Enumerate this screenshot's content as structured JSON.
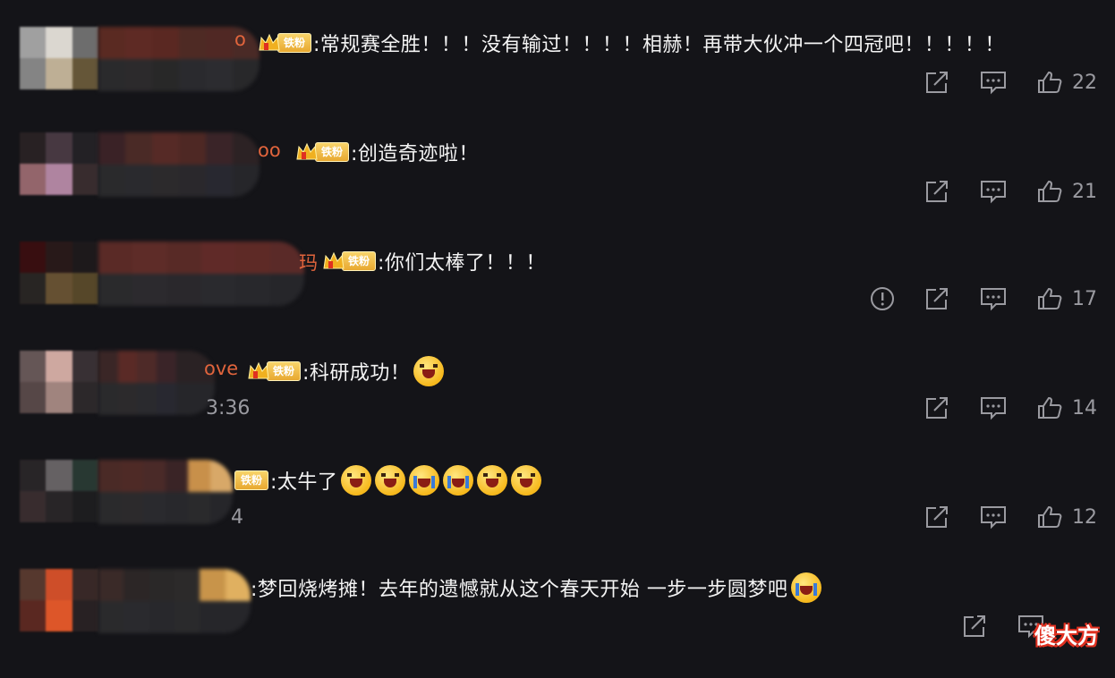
{
  "comments": [
    {
      "name_tail": "o",
      "badge": "铁粉",
      "text": ":常规赛全胜！！！没有输过！！！！相赫！再带大伙冲一个四冠吧！！！！！",
      "time": "",
      "likes": "22",
      "avatar_colors": [
        "#a8a8a8",
        "#e6e2da",
        "#727272",
        "#8a8a8a",
        "#c8b89c",
        "#6a5a3a"
      ],
      "name_colors": [
        "#5a2a22",
        "#5e2a24",
        "#5a2822",
        "#4e2a24",
        "#502824",
        "#4a2a26",
        "#2a2a2c",
        "#2c2a2c",
        "#282828",
        "#2a2a2e",
        "#2c2c30",
        "#28282a"
      ]
    },
    {
      "name_tail": "oo",
      "badge": "铁粉",
      "text": ":创造奇迹啦！",
      "time": "",
      "likes": "21",
      "avatar_colors": [
        "#2a2224",
        "#4a3a44",
        "#242226",
        "#9a6a70",
        "#b88aa8",
        "#3a2e30"
      ],
      "name_colors": [
        "#3a2226",
        "#4a2a26",
        "#562a26",
        "#4e2824",
        "#3a2428",
        "#2c2224",
        "#2a2a2c",
        "#2a2a2e",
        "#2c2a2c",
        "#2a282c",
        "#282830",
        "#26262a"
      ]
    },
    {
      "name_tail": "玛",
      "badge": "铁粉",
      "text": ":你们太棒了！！！",
      "time": "",
      "likes": "17",
      "avatar_colors": [
        "#3a0e10",
        "#2a1a1a",
        "#1e1a1c",
        "#2a2624",
        "#6a5434",
        "#5a4a2a"
      ],
      "name_colors": [
        "#5a2a26",
        "#5e2c28",
        "#582a26",
        "#602a28",
        "#5e2a26",
        "#5a2a28",
        "#2a2a2c",
        "#2c2a2e",
        "#2a282c",
        "#2a2a2e",
        "#28282c",
        "#26262a"
      ]
    },
    {
      "name_tail": "ove",
      "badge": "铁粉",
      "text": ":科研成功！",
      "time": "3:36",
      "likes": "14",
      "avatar_colors": [
        "#6a5a5a",
        "#d8b0a8",
        "#3a3236",
        "#5a4a4a",
        "#a88a84",
        "#2e2a2c"
      ],
      "name_colors": [
        "#3a2626",
        "#5a2a26",
        "#4e2a28",
        "#3a2428",
        "#2a2224",
        "#2a2224",
        "#2a2a2c",
        "#2c2a2c",
        "#2a2a2e",
        "#282830",
        "#26262a",
        "#26262a"
      ]
    },
    {
      "name_tail": "",
      "badge": "铁粉",
      "text": ":太牛了",
      "time": "4",
      "likes": "12",
      "avatar_colors": [
        "#2a2628",
        "#6a6668",
        "#2a3a34",
        "#3a2e30",
        "#2a2628",
        "#1e1e20"
      ],
      "name_colors": [
        "#4a2a26",
        "#4e2a26",
        "#4a2a28",
        "#3a2426",
        "#c8904a",
        "#d8a868",
        "#2a2a2c",
        "#2c2a2c",
        "#2a2a2e",
        "#28282c",
        "#2a2a2c",
        "#26262a"
      ]
    },
    {
      "name_tail": "",
      "badge": "",
      "text": ":梦回烧烤摊！去年的遗憾就从这个春天开始 一步一步圆梦吧",
      "time": "",
      "likes": "",
      "avatar_colors": [
        "#5a3a30",
        "#d8522a",
        "#3a2a28",
        "#5e2a22",
        "#e85a2a",
        "#2a2224"
      ],
      "name_colors": [
        "#3a2a28",
        "#2c2626",
        "#2a2828",
        "#2c2a2a",
        "#c8944a",
        "#e0b060",
        "#2a2a2c",
        "#2a2a2e",
        "#28282c",
        "#2a2a2c",
        "#26262a",
        "#26262a"
      ]
    }
  ],
  "watermark": "傻大方",
  "icons": {
    "report": "report-icon",
    "share": "share-icon",
    "reply": "comment-icon",
    "like": "like-icon"
  }
}
